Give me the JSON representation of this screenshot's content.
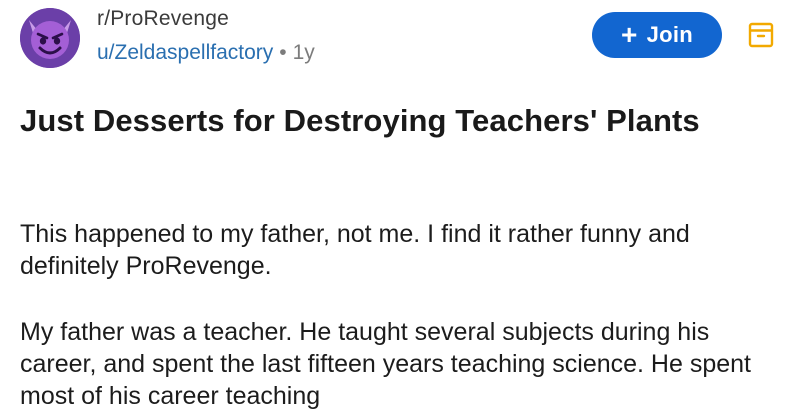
{
  "post": {
    "subreddit": "r/ProRevenge",
    "author": "u/Zeldaspellfactory",
    "separator": "•",
    "age": "1y",
    "join_label": "Join",
    "join_icon": "plus-icon",
    "title": "Just Desserts for Destroying Teachers' Plants",
    "paragraphs": [
      "This happened to my father, not me. I find it rather funny and definitely ProRevenge.",
      "My father was a teacher. He taught several subjects during his career, and spent the last fifteen years teaching science. He spent most of his career teaching"
    ]
  },
  "colors": {
    "accent": "#1266d0",
    "username": "#2a6fb0",
    "avatar_bg": "#6b3fa8",
    "save_icon": "#f2a900"
  },
  "icons": {
    "avatar": "devil-face-icon",
    "save": "save-icon"
  }
}
